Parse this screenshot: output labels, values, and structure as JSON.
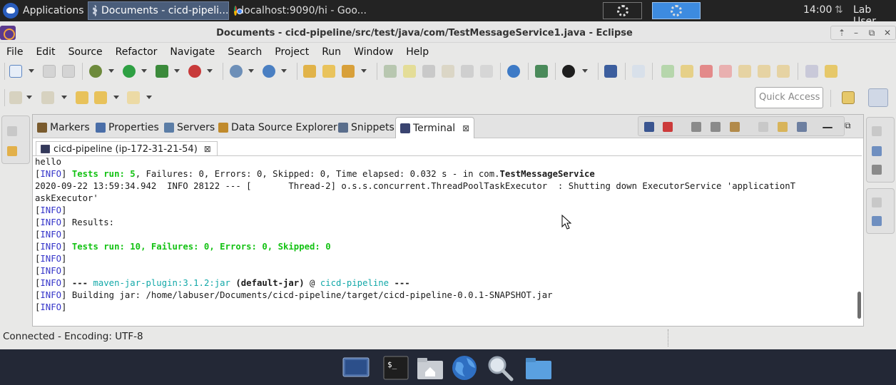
{
  "system_panel": {
    "applications_label": "Applications",
    "tasks": [
      {
        "label": "Documents - cicd-pipeli..."
      },
      {
        "label": "localhost:9090/hi - Goo..."
      }
    ],
    "clock": "14:00",
    "user": "Lab User"
  },
  "window": {
    "title": "Documents - cicd-pipeline/src/test/java/com/TestMessageService1.java - Eclipse"
  },
  "menu": [
    "File",
    "Edit",
    "Source",
    "Refactor",
    "Navigate",
    "Search",
    "Project",
    "Run",
    "Window",
    "Help"
  ],
  "quick_access": {
    "placeholder": "Quick Access"
  },
  "view_tabs": [
    {
      "label": "Markers",
      "icon": "markers-icon",
      "color": "#7a5b2e"
    },
    {
      "label": "Properties",
      "icon": "properties-icon",
      "color": "#4a6ea8"
    },
    {
      "label": "Servers",
      "icon": "servers-icon",
      "color": "#5b7da6"
    },
    {
      "label": "Data Source Explorer",
      "icon": "data-source-icon",
      "color": "#c08a2c"
    },
    {
      "label": "Snippets",
      "icon": "snippets-icon",
      "color": "#5a6e8c"
    },
    {
      "label": "Terminal",
      "icon": "terminal-icon",
      "color": "#3a4470",
      "active": true
    }
  ],
  "terminal_session": {
    "label": "cicd-pipeline (ip-172-31-21-54)"
  },
  "console_lines": [
    "hello",
    "[INFO] Tests run: 5, Failures: 0, Errors: 0, Skipped: 0, Time elapsed: 0.032 s - in com.TestMessageService",
    "2020-09-22 13:59:34.942  INFO 28122 --- [       Thread-2] o.s.s.concurrent.ThreadPoolTaskExecutor  : Shutting down ExecutorService 'applicationT",
    "askExecutor'",
    "[INFO]",
    "[INFO] Results:",
    "[INFO]",
    "[INFO] Tests run: 10, Failures: 0, Errors: 0, Skipped: 0",
    "[INFO]",
    "[INFO]",
    "[INFO] --- maven-jar-plugin:3.1.2:jar (default-jar) @ cicd-pipeline ---",
    "[INFO] Building jar: /home/labuser/Documents/cicd-pipeline/target/cicd-pipeline-0.0.1-SNAPSHOT.jar",
    "[INFO]"
  ],
  "status": {
    "text": "Connected - Encoding: UTF-8"
  },
  "colors": {
    "info_tag": "#3434c9",
    "success": "#13c213",
    "plugin": "#12a8a8",
    "panel_bg": "#232323",
    "dock_bg": "#232836"
  },
  "dock": [
    {
      "name": "show-desktop",
      "icon": "desktop-icon"
    },
    {
      "name": "terminal",
      "icon": "terminal-emulator-icon"
    },
    {
      "name": "home-folder",
      "icon": "home-folder-icon"
    },
    {
      "name": "web-browser",
      "icon": "globe-icon"
    },
    {
      "name": "app-finder",
      "icon": "magnifier-icon"
    },
    {
      "name": "file-manager",
      "icon": "folder-icon"
    }
  ]
}
